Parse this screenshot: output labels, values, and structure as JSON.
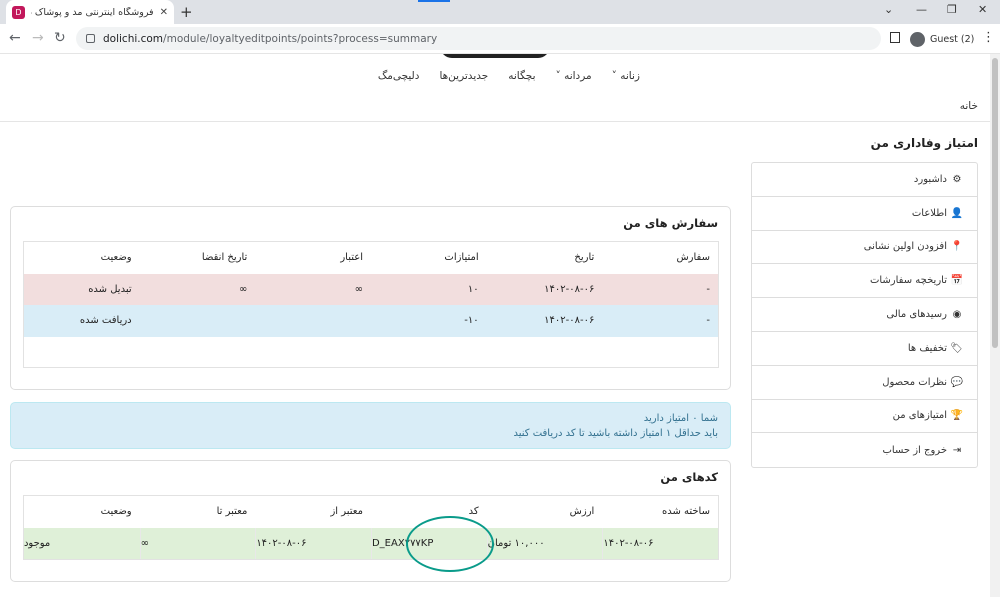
{
  "browser": {
    "tab_title": "فروشگاه اینترنتی مد و پوشاک دلیچ",
    "tab_favicon": "D",
    "new_tab_icon": "+",
    "url_domain": "dolichi.com",
    "url_path": "/module/loyaltyeditpoints/points?process=summary",
    "profile": "Guest (2)"
  },
  "topnav": [
    "زنانه ˅",
    "مردانه ˅",
    "بچگانه",
    "جدیدترین‌ها",
    "دلیچی‌مگ"
  ],
  "breadcrumb": "خانه",
  "page_title": "امتیاز وفاداری من",
  "sidebar": [
    {
      "icon": "gear-icon",
      "glyph": "⚙",
      "label": "داشبورد"
    },
    {
      "icon": "user-icon",
      "glyph": "👤",
      "label": "اطلاعات"
    },
    {
      "icon": "map-marker-icon",
      "glyph": "📍",
      "label": "افزودن اولین نشانی"
    },
    {
      "icon": "calendar-icon",
      "glyph": "📅",
      "label": "تاریخچه سفارشات"
    },
    {
      "icon": "receipt-icon",
      "glyph": "◉",
      "label": "رسیدهای مالی"
    },
    {
      "icon": "tag-icon",
      "glyph": "🏷",
      "label": "تخفیف ها"
    },
    {
      "icon": "comment-icon",
      "glyph": "💬",
      "label": "نظرات محصول"
    },
    {
      "icon": "trophy-icon",
      "glyph": "🏆",
      "label": "امتیازهای من"
    },
    {
      "icon": "sign-out-icon",
      "glyph": "⇥",
      "label": "خروج از حساب"
    }
  ],
  "orders": {
    "title": "سفارش های من",
    "headers": [
      "سفارش",
      "تاریخ",
      "امتیازات",
      "اعتبار",
      "تاریخ انقضا",
      "وضعیت"
    ],
    "rows": [
      [
        "-",
        "۱۴۰۲-۰۸-۰۶",
        "۱۰",
        "∞",
        "∞",
        "تبدیل شده"
      ],
      [
        "-",
        "۱۴۰۲-۰۸-۰۶",
        "۱۰-",
        "",
        "",
        "دریافت شده"
      ]
    ]
  },
  "alert": {
    "line1": "شما ۰ امتیاز دارید",
    "line2": "باید حداقل ۱ امتیاز داشته باشید تا کد دریافت کنید"
  },
  "codes": {
    "title": "کدهای من",
    "headers": [
      "ساخته شده",
      "ارزش",
      "کد",
      "معتبر از",
      "معتبر تا",
      "وضعیت"
    ],
    "rows": [
      [
        "۱۴۰۲-۰۸-۰۶",
        "۱۰,۰۰۰ تومان",
        "D_EAX۲۷۷KP",
        "۱۴۰۲-۰۸-۰۶",
        "∞",
        "موجود"
      ]
    ]
  },
  "colors": {
    "row_red": "#f2dede",
    "row_blue": "#d9edf7",
    "row_green": "#dff0d8",
    "annotation": "#0a9b8a"
  }
}
